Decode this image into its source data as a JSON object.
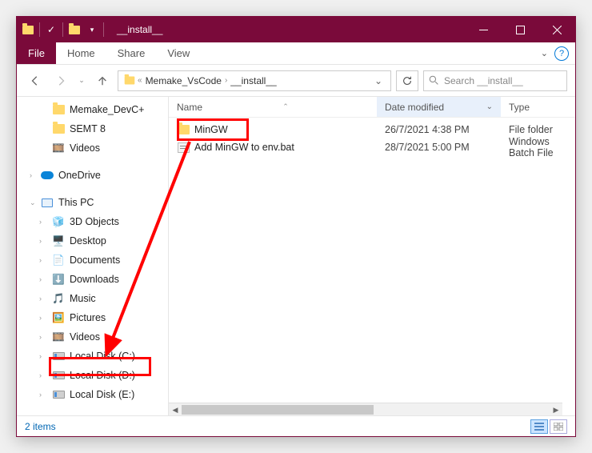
{
  "titlebar": {
    "title": "__install__"
  },
  "ribbon": {
    "file": "File",
    "home": "Home",
    "share": "Share",
    "view": "View"
  },
  "address": {
    "segments": [
      "Memake_VsCode",
      "__install__"
    ],
    "refresh_tooltip": "Refresh"
  },
  "search": {
    "placeholder": "Search __install__"
  },
  "navpane": {
    "quick": [
      {
        "label": "Memake_DevC+",
        "icon": "folder"
      },
      {
        "label": "SEMT 8",
        "icon": "folder"
      },
      {
        "label": "Videos",
        "icon": "videos"
      }
    ],
    "onedrive": "OneDrive",
    "thispc": {
      "label": "This PC",
      "children": [
        {
          "label": "3D Objects",
          "icon": "3d"
        },
        {
          "label": "Desktop",
          "icon": "desktop"
        },
        {
          "label": "Documents",
          "icon": "docs"
        },
        {
          "label": "Downloads",
          "icon": "dl"
        },
        {
          "label": "Music",
          "icon": "music"
        },
        {
          "label": "Pictures",
          "icon": "pics"
        },
        {
          "label": "Videos",
          "icon": "videos"
        },
        {
          "label": "Local Disk (C:)",
          "icon": "disk"
        },
        {
          "label": "Local Disk (D:)",
          "icon": "disk"
        },
        {
          "label": "Local Disk (E:)",
          "icon": "disk"
        }
      ]
    }
  },
  "columns": {
    "name": "Name",
    "date": "Date modified",
    "type": "Type"
  },
  "files": [
    {
      "name": "MinGW",
      "date": "26/7/2021 4:38 PM",
      "type": "File folder",
      "icon": "folder"
    },
    {
      "name": "Add MinGW to env.bat",
      "date": "28/7/2021 5:00 PM",
      "type": "Windows Batch File",
      "icon": "bat"
    }
  ],
  "status": {
    "text": "2 items"
  },
  "annotations": {
    "arrow_from": "MinGW folder",
    "arrow_to": "Local Disk (C:)"
  }
}
